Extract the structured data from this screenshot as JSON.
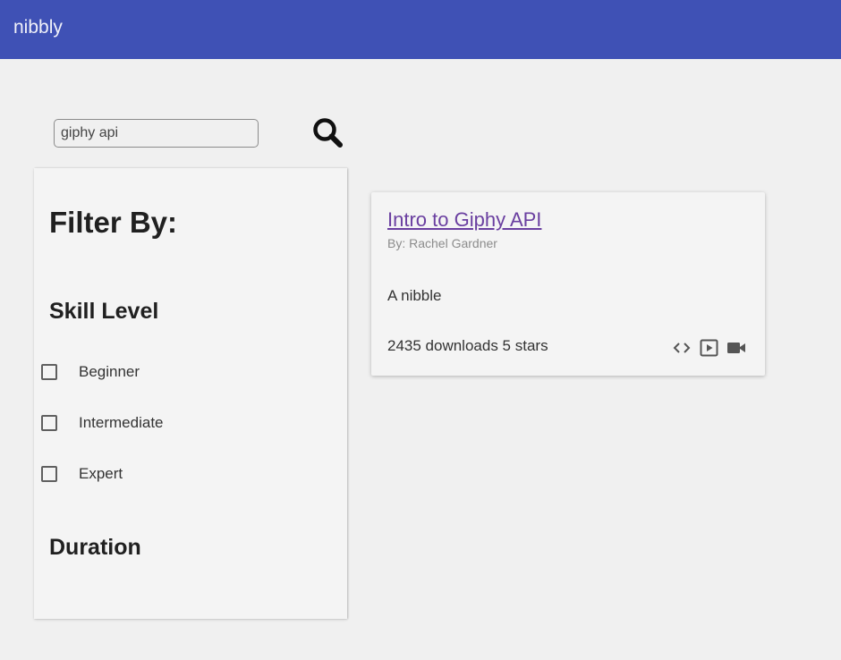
{
  "app": {
    "brand": "nibbly",
    "brand_color": "#3f51b5"
  },
  "search": {
    "value": "giphy api",
    "button_icon": "search-icon"
  },
  "filters": {
    "title": "Filter By:",
    "skill_level": {
      "title": "Skill Level",
      "options": [
        {
          "label": "Beginner",
          "checked": false
        },
        {
          "label": "Intermediate",
          "checked": false
        },
        {
          "label": "Expert",
          "checked": false
        }
      ]
    },
    "duration": {
      "title": "Duration"
    }
  },
  "results": [
    {
      "title": "Intro to Giphy API",
      "author": "By: Rachel Gardner",
      "description": "A nibble",
      "stats": "2435 downloads 5 stars",
      "icons": [
        "code-icon",
        "play-box-icon",
        "video-camera-icon"
      ],
      "title_color": "#6a3fa0"
    }
  ]
}
